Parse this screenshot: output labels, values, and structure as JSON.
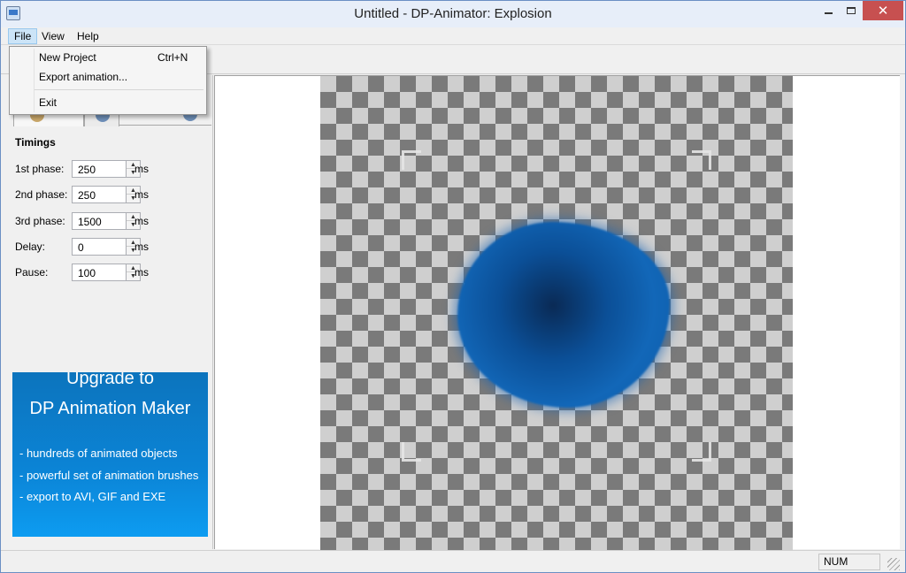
{
  "window": {
    "title": "Untitled - DP-Animator: Explosion",
    "close_glyph": "✕"
  },
  "menubar": {
    "items": [
      "File",
      "View",
      "Help"
    ]
  },
  "file_menu": {
    "items": [
      {
        "label": "New Project",
        "shortcut": "Ctrl+N"
      },
      {
        "label": "Export animation...",
        "shortcut": ""
      },
      {
        "label": "Exit",
        "shortcut": ""
      }
    ]
  },
  "timings": {
    "title": "Timings",
    "unit": "ms",
    "rows": [
      {
        "label": "1st phase:",
        "value": "250"
      },
      {
        "label": "2nd phase:",
        "value": "250"
      },
      {
        "label": "3rd phase:",
        "value": "1500"
      },
      {
        "label": "Delay:",
        "value": "0"
      },
      {
        "label": "Pause:",
        "value": "100"
      }
    ]
  },
  "promo": {
    "heading1": "Upgrade to",
    "heading2": "DP Animation Maker",
    "bullets": [
      "- hundreds of animated objects",
      "- powerful set of animation brushes",
      "- export to AVI, GIF and EXE"
    ],
    "colors": {
      "top": "#0c74bd",
      "bottom": "#0d9cf1"
    }
  },
  "statusbar": {
    "num_lock": "NUM"
  },
  "colors": {
    "blob": "#1267b8",
    "close_button": "#c75050"
  }
}
